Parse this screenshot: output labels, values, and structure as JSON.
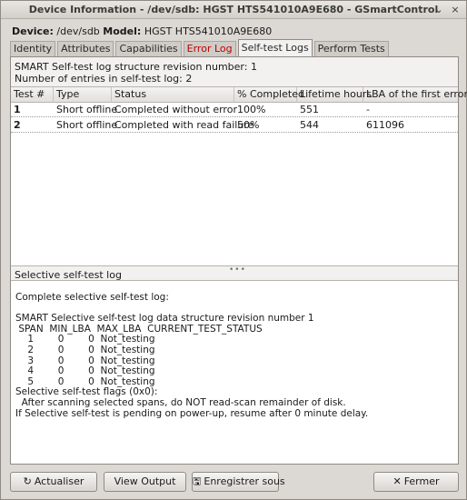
{
  "window": {
    "title": "Device Information - /dev/sdb: HGST HTS541010A9E680 - GSmartControl",
    "minimize_glyph": "⌄",
    "close_glyph": "×"
  },
  "device": {
    "device_label": "Device:",
    "device_value": "/dev/sdb",
    "model_label": "Model:",
    "model_value": "HGST HTS541010A9E680"
  },
  "tabs": [
    {
      "label": "Identity"
    },
    {
      "label": "Attributes"
    },
    {
      "label": "Capabilities"
    },
    {
      "label": "Error Log"
    },
    {
      "label": "Self-test Logs"
    },
    {
      "label": "Perform Tests"
    }
  ],
  "selftest": {
    "revision_line": "SMART Self-test log structure revision number: 1",
    "entries_line": "Number of entries in self-test log: 2",
    "columns": [
      "Test #",
      "Type",
      "Status",
      "% Completed",
      "Lifetime hours",
      "LBA of the first error"
    ],
    "rows": [
      [
        "1",
        "Short offline",
        "Completed without error",
        "100%",
        "551",
        "-"
      ],
      [
        "2",
        "Short offline",
        "Completed with read failure",
        "50%",
        "544",
        "611096"
      ]
    ],
    "splitter_glyph": "•••"
  },
  "selective": {
    "label": "Selective self-test log",
    "log_text": "Complete selective self-test log:\n\nSMART Selective self-test log data structure revision number 1\n SPAN  MIN_LBA  MAX_LBA  CURRENT_TEST_STATUS\n    1        0        0  Not_testing\n    2        0        0  Not_testing\n    3        0        0  Not_testing\n    4        0        0  Not_testing\n    5        0        0  Not_testing\nSelective self-test flags (0x0):\n  After scanning selected spans, do NOT read-scan remainder of disk.\nIf Selective self-test is pending on power-up, resume after 0 minute delay."
  },
  "buttons": {
    "refresh": {
      "icon": "↻",
      "label": "Actualiser"
    },
    "view_output": {
      "label": "View Output"
    },
    "save": {
      "icon": "🖫",
      "label": "Enregistrer sous"
    },
    "close": {
      "icon": "✕",
      "label": "Fermer"
    }
  }
}
